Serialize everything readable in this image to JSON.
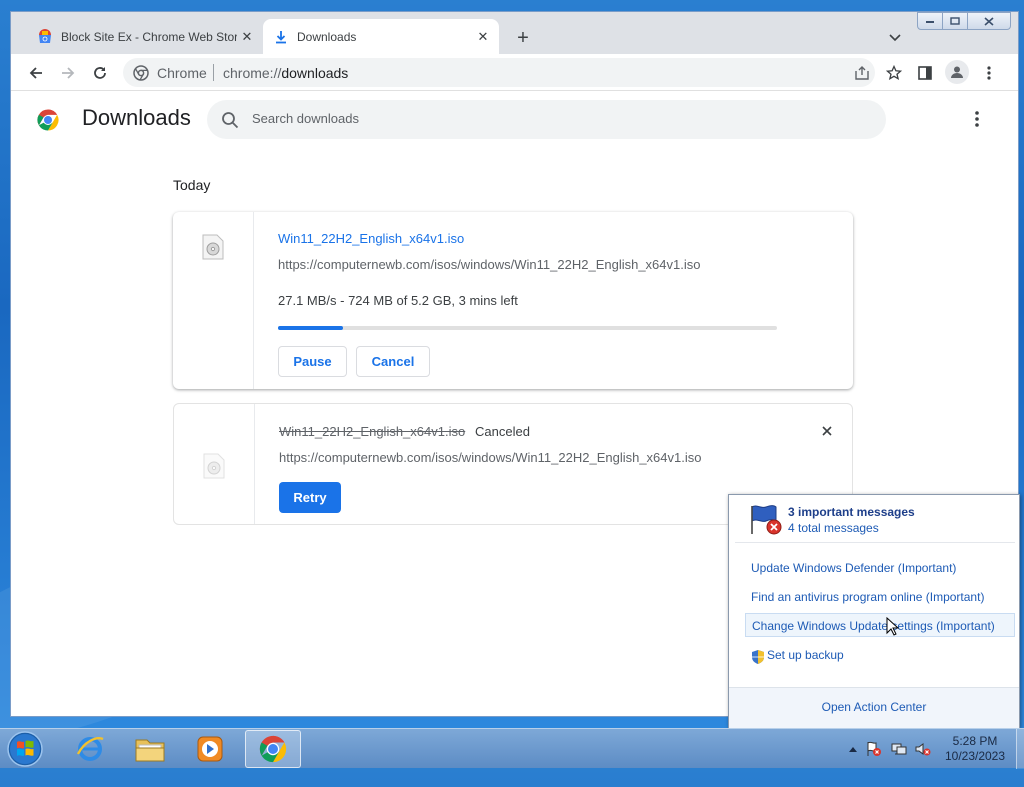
{
  "browser": {
    "tabs": [
      {
        "title": "Block Site Ex - Chrome Web Store",
        "active": false
      },
      {
        "title": "Downloads",
        "active": true
      }
    ],
    "omnibox": {
      "site_label": "Chrome",
      "url_scheme": "chrome://",
      "url_rest": "downloads"
    }
  },
  "page": {
    "title": "Downloads",
    "search_placeholder": "Search downloads",
    "section_label": "Today",
    "downloads": [
      {
        "file_name": "Win11_22H2_English_x64v1.iso",
        "url": "https://computernewb.com/isos/windows/Win11_22H2_English_x64v1.iso",
        "progress_text": "27.1 MB/s - 724 MB of 5.2 GB, 3 mins left",
        "progress_fraction": 0.13,
        "pause_label": "Pause",
        "cancel_label": "Cancel"
      },
      {
        "file_name": "Win11_22H2_English_x64v1.iso",
        "status": "Canceled",
        "url": "https://computernewb.com/isos/windows/Win11_22H2_English_x64v1.iso",
        "retry_label": "Retry"
      }
    ]
  },
  "action_center": {
    "heading": "3 important messages",
    "subheading": "4 total messages",
    "items": [
      "Update Windows Defender (Important)",
      "Find an antivirus program online (Important)",
      "Change Windows Update settings (Important)",
      "Set up backup"
    ],
    "open_label": "Open Action Center"
  },
  "taskbar": {
    "time": "5:28 PM",
    "date": "10/23/2023"
  },
  "colors": {
    "chrome_blue": "#1a73e8",
    "ac_link": "#1e5bb5",
    "taskbar_top": "#82aad7"
  },
  "icons": [
    "chrome-icon",
    "download-icon",
    "close-icon",
    "plus-icon",
    "chevron-down-icon",
    "back-icon",
    "forward-icon",
    "reload-icon",
    "share-icon",
    "star-icon",
    "side-panel-icon",
    "profile-icon",
    "kebab-icon",
    "search-icon",
    "file-icon",
    "flag-icon",
    "shield-icon",
    "start-orb-icon",
    "ie-icon",
    "folder-icon",
    "media-player-icon",
    "action-center-icon",
    "network-icon",
    "volume-mute-icon"
  ]
}
